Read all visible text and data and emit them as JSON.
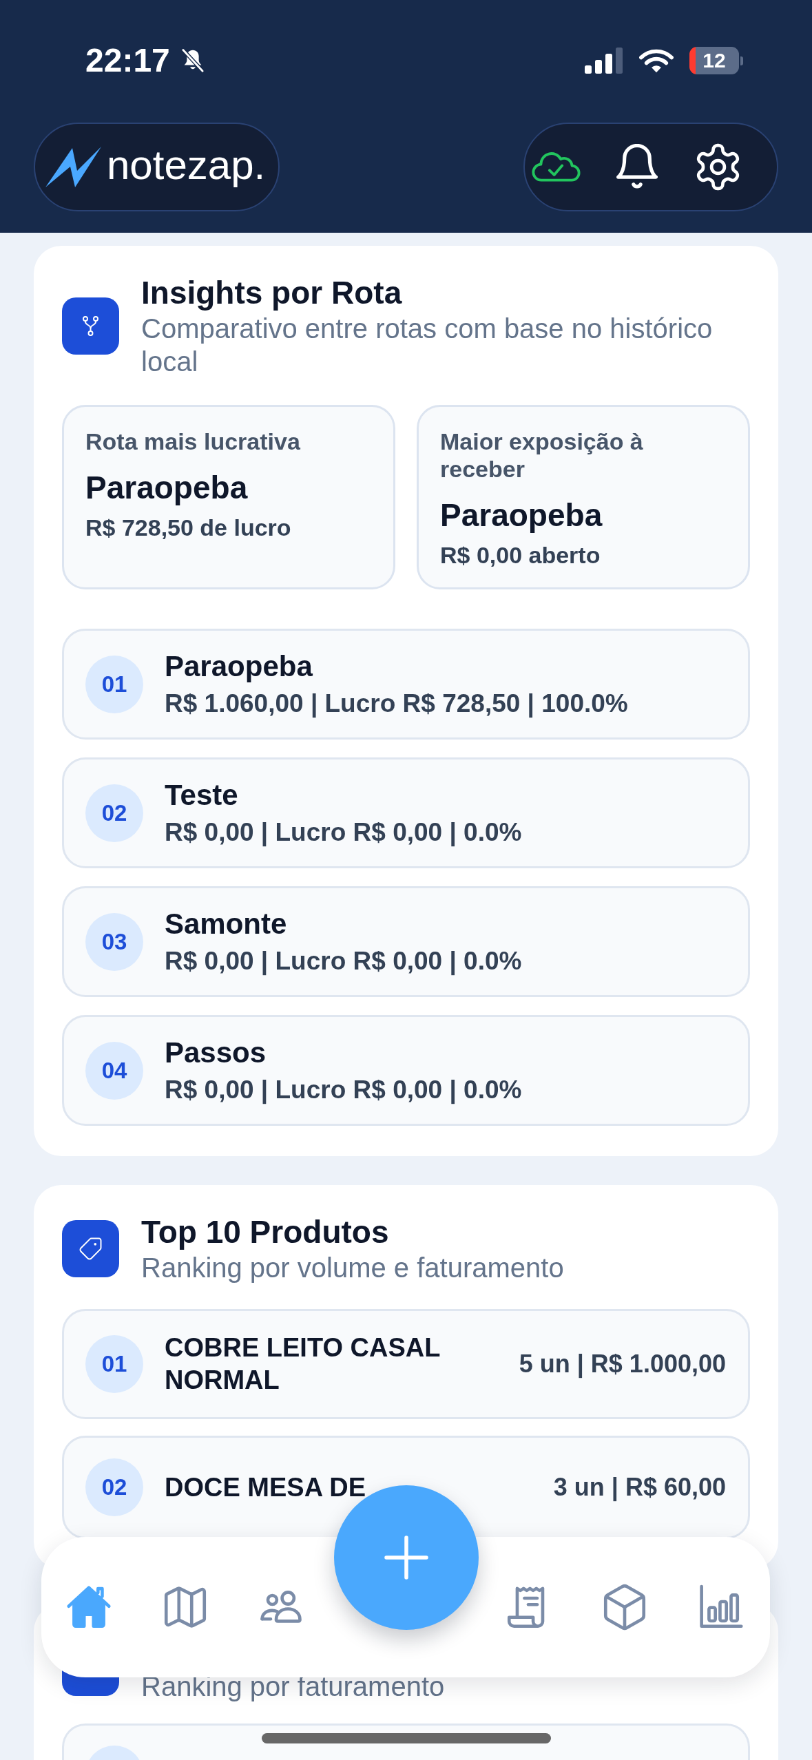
{
  "status_bar": {
    "time": "22:17",
    "battery": "12"
  },
  "header": {
    "logo": "notezap."
  },
  "route_insights": {
    "title": "Insights por Rota",
    "subtitle": "Comparativo entre rotas com base no histórico local",
    "highlights": [
      {
        "label": "Rota mais lucrativa",
        "value": "Paraopeba",
        "detail": "R$ 728,50 de lucro"
      },
      {
        "label": "Maior exposição à receber",
        "value": "Paraopeba",
        "detail": "R$ 0,00 aberto"
      }
    ],
    "routes": [
      {
        "rank": "01",
        "name": "Paraopeba",
        "summary": "R$ 1.060,00 | Lucro R$ 728,50 | 100.0%"
      },
      {
        "rank": "02",
        "name": "Teste",
        "summary": "R$ 0,00 | Lucro R$ 0,00 | 0.0%"
      },
      {
        "rank": "03",
        "name": "Samonte",
        "summary": "R$ 0,00 | Lucro R$ 0,00 | 0.0%"
      },
      {
        "rank": "04",
        "name": "Passos",
        "summary": "R$ 0,00 | Lucro R$ 0,00 | 0.0%"
      }
    ]
  },
  "top_products": {
    "title": "Top 10 Produtos",
    "subtitle": "Ranking por volume e faturamento",
    "items": [
      {
        "rank": "01",
        "name": "COBRE LEITO CASAL NORMAL",
        "summary": "5 un | R$ 1.000,00"
      },
      {
        "rank": "02",
        "name": "DOCE MESA DE",
        "summary": "3 un | R$ 60,00"
      }
    ]
  },
  "ranking_card": {
    "subtitle": "Ranking por faturamento"
  },
  "bottom_nav": {
    "items": [
      {
        "selected": true
      },
      {
        "selected": false
      },
      {
        "selected": false
      },
      {
        "selected": false
      },
      {
        "selected": false
      },
      {
        "selected": false
      }
    ]
  }
}
